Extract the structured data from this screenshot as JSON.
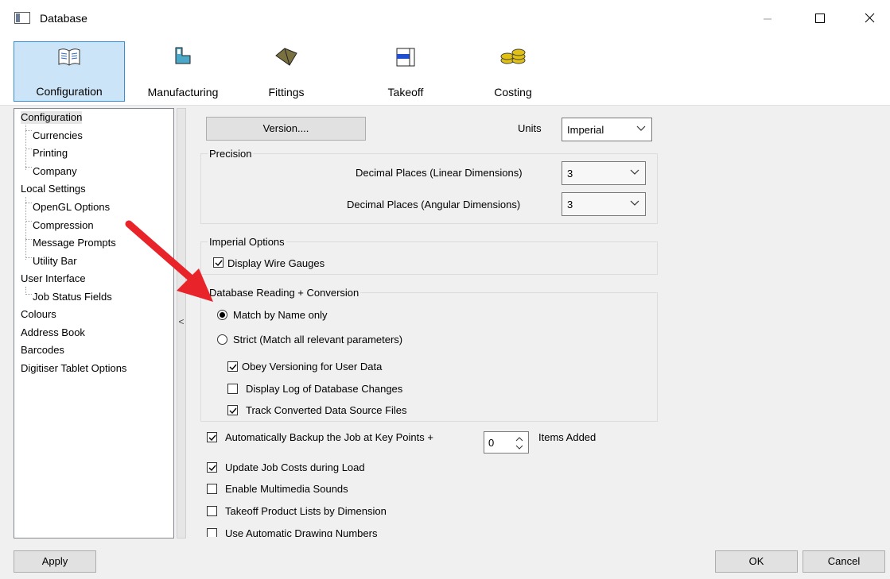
{
  "window": {
    "title": "Database"
  },
  "ribbon": {
    "tabs": [
      {
        "label": "Configuration"
      },
      {
        "label": "Manufacturing"
      },
      {
        "label": "Fittings"
      },
      {
        "label": "Takeoff"
      },
      {
        "label": "Costing"
      }
    ]
  },
  "tree": {
    "items": [
      {
        "label": "Configuration"
      },
      {
        "label": "Currencies"
      },
      {
        "label": "Printing"
      },
      {
        "label": "Company"
      },
      {
        "label": "Local Settings"
      },
      {
        "label": "OpenGL Options"
      },
      {
        "label": "Compression"
      },
      {
        "label": "Message Prompts"
      },
      {
        "label": "Utility Bar"
      },
      {
        "label": "User Interface"
      },
      {
        "label": "Job Status Fields"
      },
      {
        "label": "Colours"
      },
      {
        "label": "Address Book"
      },
      {
        "label": "Barcodes"
      },
      {
        "label": "Digitiser Tablet Options"
      }
    ],
    "collapse_glyph": "<"
  },
  "config": {
    "version_button": "Version....",
    "units_label": "Units",
    "units_value": "Imperial",
    "precision": {
      "label": "Precision",
      "linear_label": "Decimal Places (Linear Dimensions)",
      "linear_value": "3",
      "angular_label": "Decimal Places (Angular Dimensions)",
      "angular_value": "3"
    },
    "imperial": {
      "label": "Imperial Options",
      "wire_gauges": "Display Wire Gauges"
    },
    "db_reading": {
      "label": "Database Reading + Conversion",
      "match_name": "Match by Name only",
      "strict": "Strict (Match all relevant parameters)",
      "obey_versioning": "Obey Versioning for User Data",
      "display_log": "Display Log of Database Changes",
      "track_converted": "Track Converted Data Source Files"
    },
    "backup_label": "Automatically Backup the Job at Key Points +",
    "backup_value": "0",
    "items_added": "Items Added",
    "update_costs": "Update Job Costs during Load",
    "multimedia": "Enable Multimedia Sounds",
    "takeoff_lists": "Takeoff Product Lists by Dimension",
    "auto_drawing": "Use Automatic Drawing Numbers"
  },
  "footer": {
    "apply": "Apply",
    "ok": "OK",
    "cancel": "Cancel"
  },
  "colors": {
    "accent": "#3b8dd4",
    "selected_tab_bg": "#cce4f7",
    "arrow": "#e8242a"
  }
}
